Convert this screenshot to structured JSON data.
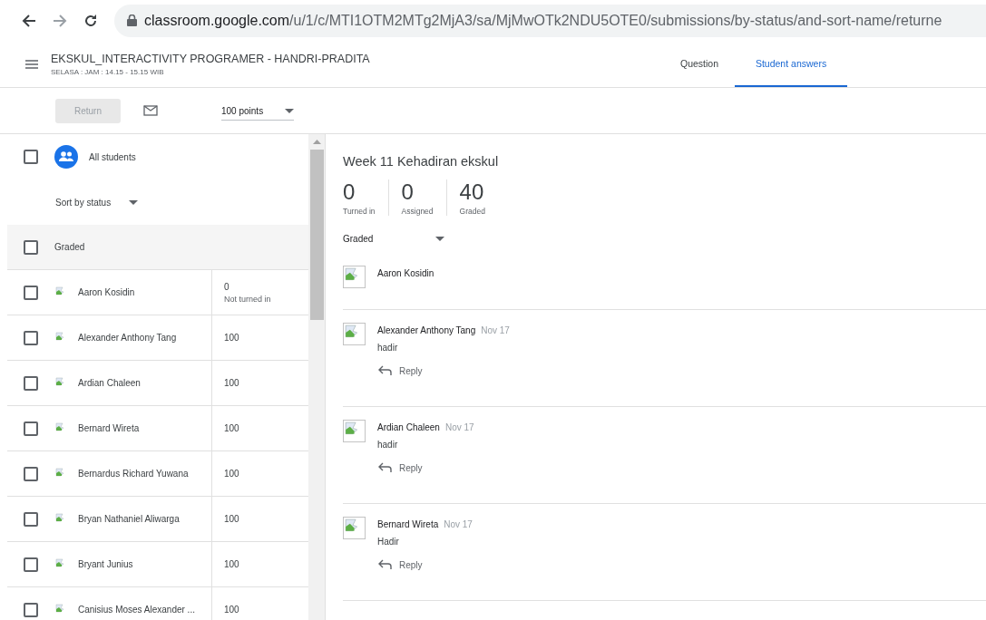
{
  "browser": {
    "url_host": "classroom.google.com",
    "url_path": "/u/1/c/MTI1OTM2MTg2MjA3/sa/MjMwOTk2NDU5OTE0/submissions/by-status/and-sort-name/returne"
  },
  "header": {
    "title": "EKSKUL_INTERACTIVITY PROGRAMER - HANDRI-PRADITA",
    "subtitle": "SELASA : JAM : 14.15 - 15.15 WIB"
  },
  "tabs": [
    {
      "label": "Question",
      "selected": false
    },
    {
      "label": "Student answers",
      "selected": true
    }
  ],
  "toolbar": {
    "return_button": {
      "label": "Return",
      "disabled": true
    },
    "points": "100 points"
  },
  "student_list": {
    "all_students": {
      "label": "All students",
      "checked": false
    },
    "sort": "Sort by status",
    "group": {
      "label": "Graded",
      "checked": false
    },
    "rows": [
      {
        "name": "Aaron Kosidin",
        "grade": "0",
        "note": "Not turned in",
        "checked": false
      },
      {
        "name": "Alexander Anthony Tang",
        "grade": "100",
        "checked": false
      },
      {
        "name": "Ardian Chaleen",
        "grade": "100",
        "checked": false
      },
      {
        "name": "Bernard Wireta",
        "grade": "100",
        "checked": false
      },
      {
        "name": "Bernardus Richard Yuwana",
        "grade": "100",
        "checked": false
      },
      {
        "name": "Bryan Nathaniel Aliwarga",
        "grade": "100",
        "checked": false
      },
      {
        "name": "Bryant Junius",
        "grade": "100",
        "checked": false
      },
      {
        "name": "Canisius Moses Alexander ...",
        "grade": "100",
        "checked": false
      }
    ]
  },
  "answers": {
    "title": "Week 11 Kehadiran ekskul",
    "stats": [
      {
        "value": "0",
        "label": "Turned in"
      },
      {
        "value": "0",
        "label": "Assigned"
      },
      {
        "value": "40",
        "label": "Graded"
      }
    ],
    "filter": "Graded",
    "entries": [
      {
        "name": "Aaron Kosidin"
      },
      {
        "name": "Alexander Anthony Tang",
        "date": "Nov 17",
        "answer": "hadir",
        "reply": "Reply"
      },
      {
        "name": "Ardian Chaleen",
        "date": "Nov 17",
        "answer": "hadir",
        "reply": "Reply"
      },
      {
        "name": "Bernard Wireta",
        "date": "Nov 17",
        "answer": "Hadir",
        "reply": "Reply"
      }
    ]
  }
}
